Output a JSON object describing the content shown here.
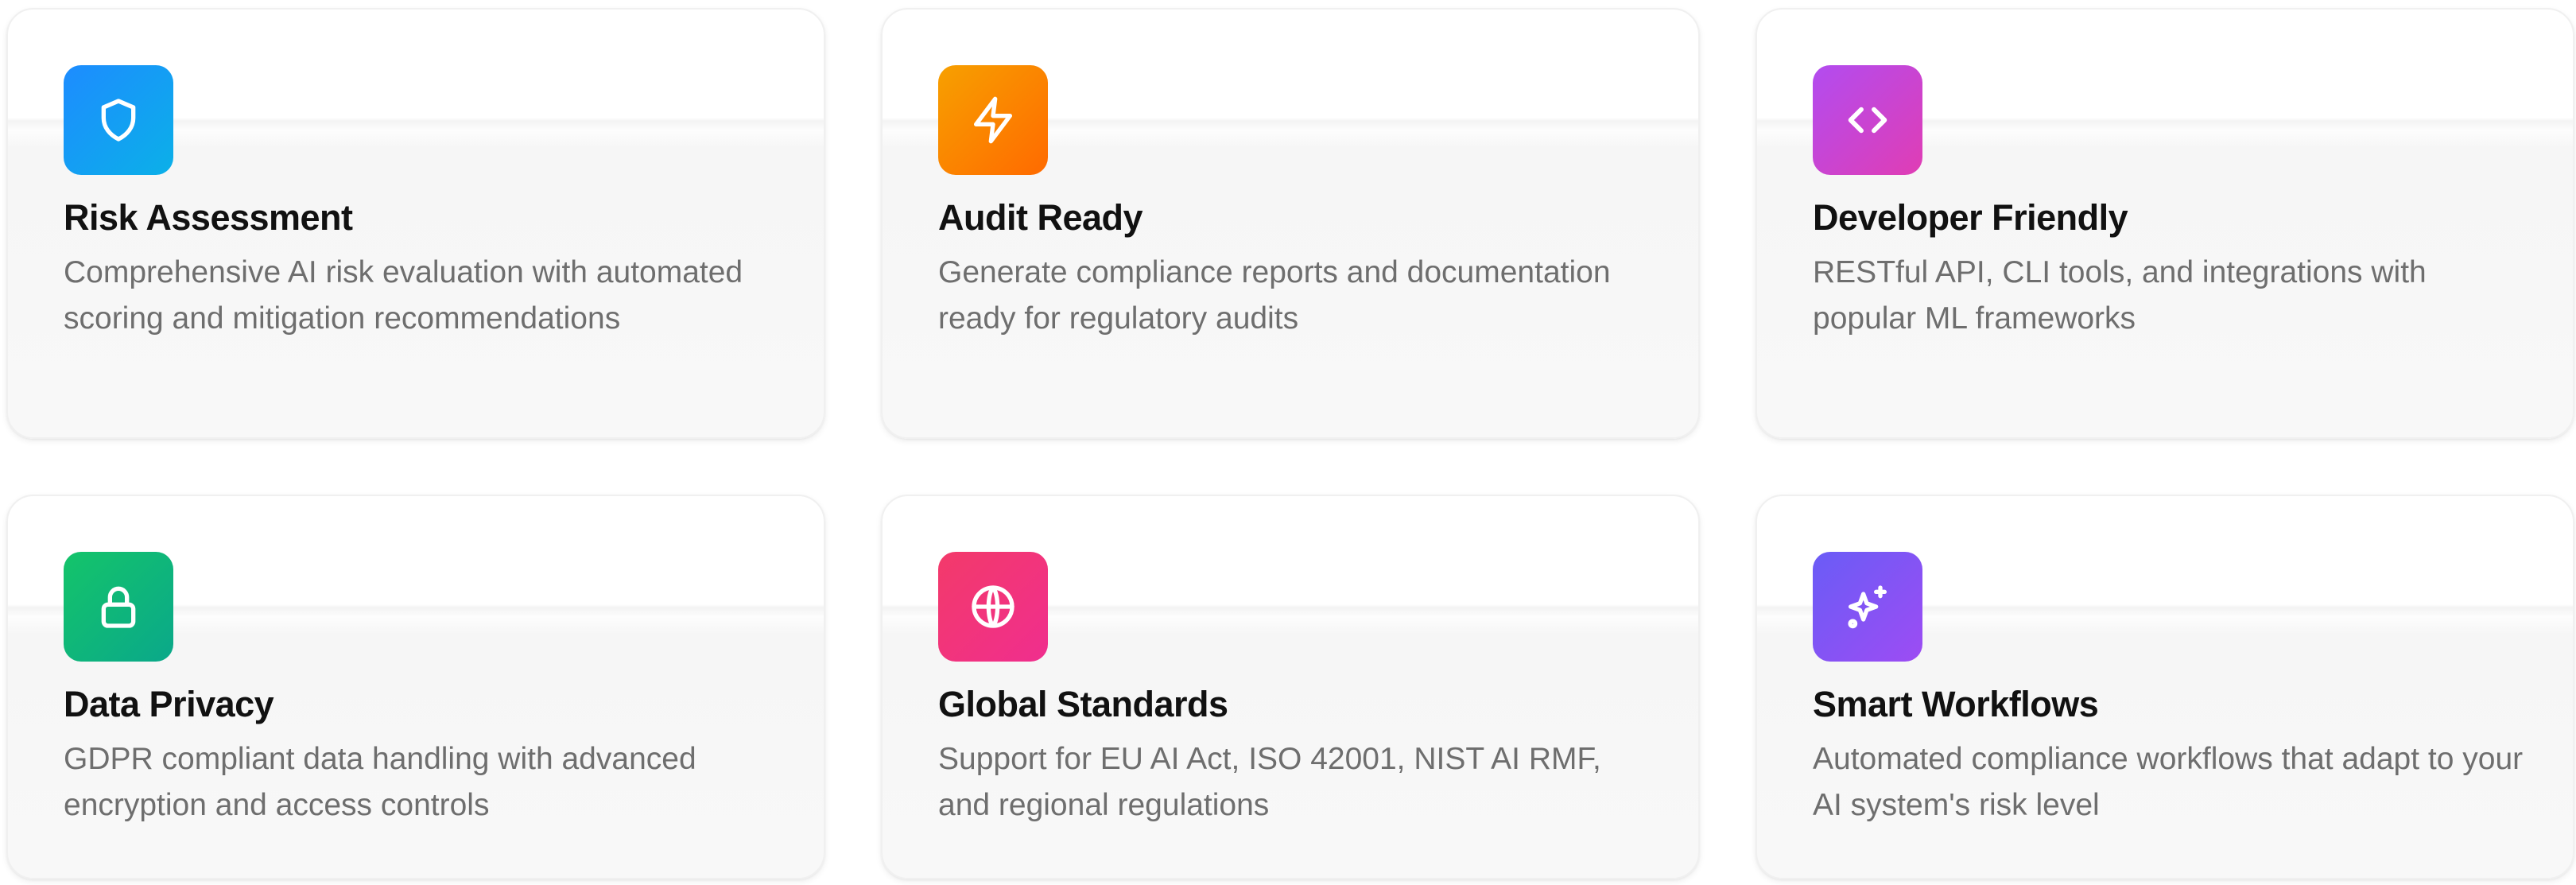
{
  "features": [
    {
      "title": "Risk Assessment",
      "description": "Comprehensive AI risk evaluation with automated scoring and mitigation recommendations",
      "icon": "shield-icon",
      "gradient": [
        "#1d8cff",
        "#0bb0e8"
      ]
    },
    {
      "title": "Audit Ready",
      "description": "Generate compliance reports and documentation ready for regulatory audits",
      "icon": "lightning-icon",
      "gradient": [
        "#f7a000",
        "#ff6a00"
      ]
    },
    {
      "title": "Developer Friendly",
      "description": "RESTful API, CLI tools, and integrations with popular ML frameworks",
      "icon": "code-icon",
      "gradient": [
        "#b24cf0",
        "#e03db4"
      ]
    },
    {
      "title": "Data Privacy",
      "description": "GDPR compliant data handling with advanced encryption and access controls",
      "icon": "lock-icon",
      "gradient": [
        "#14c46a",
        "#0aa88a"
      ]
    },
    {
      "title": "Global Standards",
      "description": "Support for EU AI Act, ISO 42001, NIST AI RMF, and regional regulations",
      "icon": "globe-icon",
      "gradient": [
        "#f33a6a",
        "#f02e8e"
      ]
    },
    {
      "title": "Smart Workflows",
      "description": "Automated compliance workflows that adapt to your AI system's risk level",
      "icon": "sparkles-icon",
      "gradient": [
        "#6a5cf6",
        "#9d4cf3"
      ]
    }
  ]
}
